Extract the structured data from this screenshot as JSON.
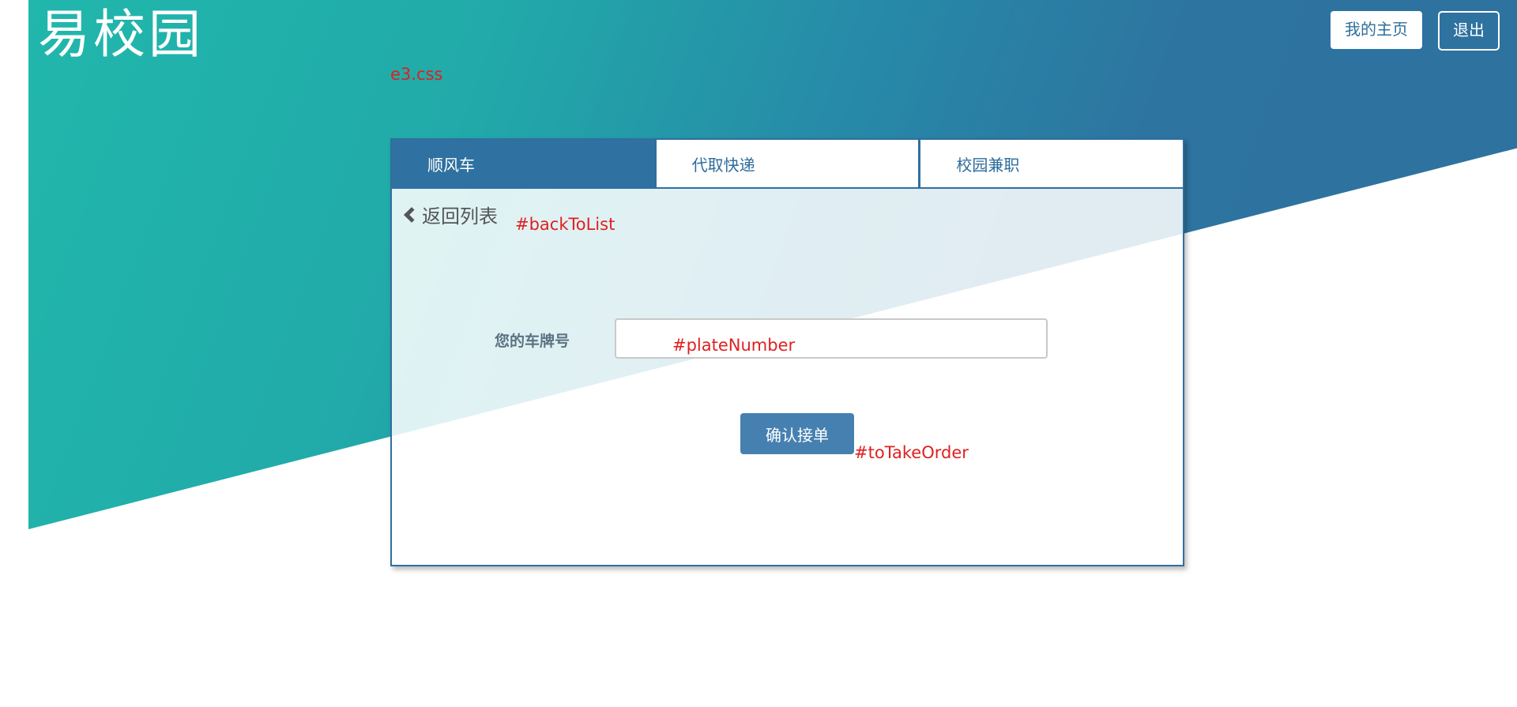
{
  "brand": {
    "logo_text": "易校园"
  },
  "header": {
    "home_label": "我的主页",
    "logout_label": "退出"
  },
  "annotations": {
    "css_file": "e3.css",
    "back_id": "#backToList",
    "plate_id": "#plateNumber",
    "take_order_id": "#toTakeOrder"
  },
  "tabs": [
    {
      "label": "顺风车",
      "active": true
    },
    {
      "label": "代取快递",
      "active": false
    },
    {
      "label": "校园兼职",
      "active": false
    }
  ],
  "back": {
    "label": "返回列表"
  },
  "form": {
    "plate_label": "您的车牌号",
    "plate_value": "",
    "confirm_label": "确认接单"
  },
  "colors": {
    "gradient_start": "#21b7ac",
    "gradient_end": "#2f71a0",
    "accent": "#2f6f9f",
    "button": "#4680b0",
    "annotation": "#e02020"
  }
}
